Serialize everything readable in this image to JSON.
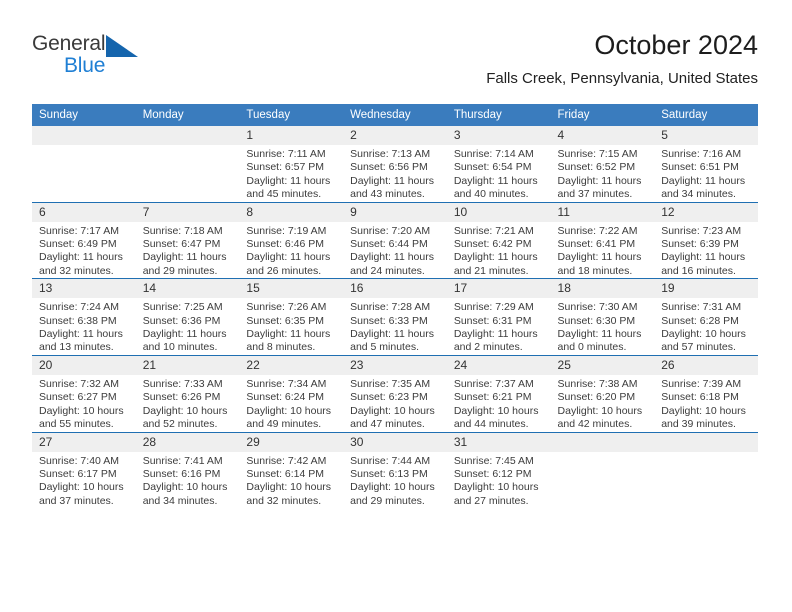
{
  "logo": {
    "word1": "General",
    "word2": "Blue",
    "triangle_color": "#1565ad",
    "blue_color": "#1f7fd4"
  },
  "header": {
    "title": "October 2024",
    "subtitle": "Falls Creek, Pennsylvania, United States"
  },
  "theme": {
    "header_blue": "#3a7cbe",
    "rule_blue": "#1f6fb2",
    "daynum_band": "#efefef"
  },
  "calendar": {
    "weekday_headers": [
      "Sunday",
      "Monday",
      "Tuesday",
      "Wednesday",
      "Thursday",
      "Friday",
      "Saturday"
    ],
    "weeks": [
      [
        {
          "day": "",
          "sunrise": "",
          "sunset": "",
          "daylight_line1": "",
          "daylight_line2": ""
        },
        {
          "day": "",
          "sunrise": "",
          "sunset": "",
          "daylight_line1": "",
          "daylight_line2": ""
        },
        {
          "day": "1",
          "sunrise": "Sunrise: 7:11 AM",
          "sunset": "Sunset: 6:57 PM",
          "daylight_line1": "Daylight: 11 hours",
          "daylight_line2": "and 45 minutes."
        },
        {
          "day": "2",
          "sunrise": "Sunrise: 7:13 AM",
          "sunset": "Sunset: 6:56 PM",
          "daylight_line1": "Daylight: 11 hours",
          "daylight_line2": "and 43 minutes."
        },
        {
          "day": "3",
          "sunrise": "Sunrise: 7:14 AM",
          "sunset": "Sunset: 6:54 PM",
          "daylight_line1": "Daylight: 11 hours",
          "daylight_line2": "and 40 minutes."
        },
        {
          "day": "4",
          "sunrise": "Sunrise: 7:15 AM",
          "sunset": "Sunset: 6:52 PM",
          "daylight_line1": "Daylight: 11 hours",
          "daylight_line2": "and 37 minutes."
        },
        {
          "day": "5",
          "sunrise": "Sunrise: 7:16 AM",
          "sunset": "Sunset: 6:51 PM",
          "daylight_line1": "Daylight: 11 hours",
          "daylight_line2": "and 34 minutes."
        }
      ],
      [
        {
          "day": "6",
          "sunrise": "Sunrise: 7:17 AM",
          "sunset": "Sunset: 6:49 PM",
          "daylight_line1": "Daylight: 11 hours",
          "daylight_line2": "and 32 minutes."
        },
        {
          "day": "7",
          "sunrise": "Sunrise: 7:18 AM",
          "sunset": "Sunset: 6:47 PM",
          "daylight_line1": "Daylight: 11 hours",
          "daylight_line2": "and 29 minutes."
        },
        {
          "day": "8",
          "sunrise": "Sunrise: 7:19 AM",
          "sunset": "Sunset: 6:46 PM",
          "daylight_line1": "Daylight: 11 hours",
          "daylight_line2": "and 26 minutes."
        },
        {
          "day": "9",
          "sunrise": "Sunrise: 7:20 AM",
          "sunset": "Sunset: 6:44 PM",
          "daylight_line1": "Daylight: 11 hours",
          "daylight_line2": "and 24 minutes."
        },
        {
          "day": "10",
          "sunrise": "Sunrise: 7:21 AM",
          "sunset": "Sunset: 6:42 PM",
          "daylight_line1": "Daylight: 11 hours",
          "daylight_line2": "and 21 minutes."
        },
        {
          "day": "11",
          "sunrise": "Sunrise: 7:22 AM",
          "sunset": "Sunset: 6:41 PM",
          "daylight_line1": "Daylight: 11 hours",
          "daylight_line2": "and 18 minutes."
        },
        {
          "day": "12",
          "sunrise": "Sunrise: 7:23 AM",
          "sunset": "Sunset: 6:39 PM",
          "daylight_line1": "Daylight: 11 hours",
          "daylight_line2": "and 16 minutes."
        }
      ],
      [
        {
          "day": "13",
          "sunrise": "Sunrise: 7:24 AM",
          "sunset": "Sunset: 6:38 PM",
          "daylight_line1": "Daylight: 11 hours",
          "daylight_line2": "and 13 minutes."
        },
        {
          "day": "14",
          "sunrise": "Sunrise: 7:25 AM",
          "sunset": "Sunset: 6:36 PM",
          "daylight_line1": "Daylight: 11 hours",
          "daylight_line2": "and 10 minutes."
        },
        {
          "day": "15",
          "sunrise": "Sunrise: 7:26 AM",
          "sunset": "Sunset: 6:35 PM",
          "daylight_line1": "Daylight: 11 hours",
          "daylight_line2": "and 8 minutes."
        },
        {
          "day": "16",
          "sunrise": "Sunrise: 7:28 AM",
          "sunset": "Sunset: 6:33 PM",
          "daylight_line1": "Daylight: 11 hours",
          "daylight_line2": "and 5 minutes."
        },
        {
          "day": "17",
          "sunrise": "Sunrise: 7:29 AM",
          "sunset": "Sunset: 6:31 PM",
          "daylight_line1": "Daylight: 11 hours",
          "daylight_line2": "and 2 minutes."
        },
        {
          "day": "18",
          "sunrise": "Sunrise: 7:30 AM",
          "sunset": "Sunset: 6:30 PM",
          "daylight_line1": "Daylight: 11 hours",
          "daylight_line2": "and 0 minutes."
        },
        {
          "day": "19",
          "sunrise": "Sunrise: 7:31 AM",
          "sunset": "Sunset: 6:28 PM",
          "daylight_line1": "Daylight: 10 hours",
          "daylight_line2": "and 57 minutes."
        }
      ],
      [
        {
          "day": "20",
          "sunrise": "Sunrise: 7:32 AM",
          "sunset": "Sunset: 6:27 PM",
          "daylight_line1": "Daylight: 10 hours",
          "daylight_line2": "and 55 minutes."
        },
        {
          "day": "21",
          "sunrise": "Sunrise: 7:33 AM",
          "sunset": "Sunset: 6:26 PM",
          "daylight_line1": "Daylight: 10 hours",
          "daylight_line2": "and 52 minutes."
        },
        {
          "day": "22",
          "sunrise": "Sunrise: 7:34 AM",
          "sunset": "Sunset: 6:24 PM",
          "daylight_line1": "Daylight: 10 hours",
          "daylight_line2": "and 49 minutes."
        },
        {
          "day": "23",
          "sunrise": "Sunrise: 7:35 AM",
          "sunset": "Sunset: 6:23 PM",
          "daylight_line1": "Daylight: 10 hours",
          "daylight_line2": "and 47 minutes."
        },
        {
          "day": "24",
          "sunrise": "Sunrise: 7:37 AM",
          "sunset": "Sunset: 6:21 PM",
          "daylight_line1": "Daylight: 10 hours",
          "daylight_line2": "and 44 minutes."
        },
        {
          "day": "25",
          "sunrise": "Sunrise: 7:38 AM",
          "sunset": "Sunset: 6:20 PM",
          "daylight_line1": "Daylight: 10 hours",
          "daylight_line2": "and 42 minutes."
        },
        {
          "day": "26",
          "sunrise": "Sunrise: 7:39 AM",
          "sunset": "Sunset: 6:18 PM",
          "daylight_line1": "Daylight: 10 hours",
          "daylight_line2": "and 39 minutes."
        }
      ],
      [
        {
          "day": "27",
          "sunrise": "Sunrise: 7:40 AM",
          "sunset": "Sunset: 6:17 PM",
          "daylight_line1": "Daylight: 10 hours",
          "daylight_line2": "and 37 minutes."
        },
        {
          "day": "28",
          "sunrise": "Sunrise: 7:41 AM",
          "sunset": "Sunset: 6:16 PM",
          "daylight_line1": "Daylight: 10 hours",
          "daylight_line2": "and 34 minutes."
        },
        {
          "day": "29",
          "sunrise": "Sunrise: 7:42 AM",
          "sunset": "Sunset: 6:14 PM",
          "daylight_line1": "Daylight: 10 hours",
          "daylight_line2": "and 32 minutes."
        },
        {
          "day": "30",
          "sunrise": "Sunrise: 7:44 AM",
          "sunset": "Sunset: 6:13 PM",
          "daylight_line1": "Daylight: 10 hours",
          "daylight_line2": "and 29 minutes."
        },
        {
          "day": "31",
          "sunrise": "Sunrise: 7:45 AM",
          "sunset": "Sunset: 6:12 PM",
          "daylight_line1": "Daylight: 10 hours",
          "daylight_line2": "and 27 minutes."
        },
        {
          "day": "",
          "sunrise": "",
          "sunset": "",
          "daylight_line1": "",
          "daylight_line2": ""
        },
        {
          "day": "",
          "sunrise": "",
          "sunset": "",
          "daylight_line1": "",
          "daylight_line2": ""
        }
      ]
    ]
  }
}
